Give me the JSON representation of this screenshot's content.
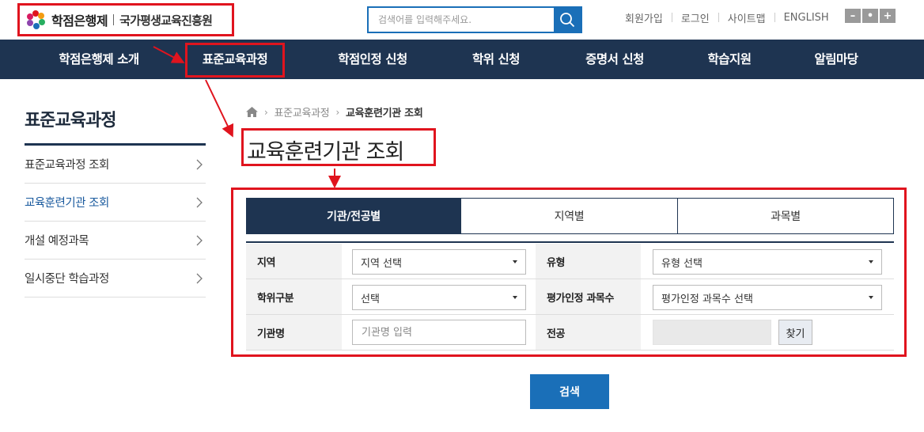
{
  "header": {
    "logo_name": "학점은행제",
    "logo_org": "국가평생교육진흥원",
    "search_placeholder": "검색어를 입력해주세요.",
    "util_links": [
      "회원가입",
      "로그인",
      "사이트맵",
      "ENGLISH"
    ],
    "font_controls": [
      "–",
      "•",
      "+"
    ]
  },
  "gnb": [
    "학점은행제 소개",
    "표준교육과정",
    "학점인정 신청",
    "학위 신청",
    "증명서 신청",
    "학습지원",
    "알림마당"
  ],
  "sidebar": {
    "title": "표준교육과정",
    "items": [
      "표준교육과정 조회",
      "교육훈련기관 조회",
      "개설 예정과목",
      "일시중단 학습과정"
    ]
  },
  "breadcrumb": {
    "parent": "표준교육과정",
    "current": "교육훈련기관 조회"
  },
  "page_title": "교육훈련기관 조회",
  "tabs": [
    "기관/전공별",
    "지역별",
    "과목별"
  ],
  "form": {
    "region_label": "지역",
    "region_value": "지역 선택",
    "type_label": "유형",
    "type_value": "유형 선택",
    "degree_label": "학위구분",
    "degree_value": "선택",
    "eval_label": "평가인정 과목수",
    "eval_value": "평가인정 과목수 선택",
    "inst_label": "기관명",
    "inst_placeholder": "기관명 입력",
    "major_label": "전공",
    "find_label": "찾기"
  },
  "search_button": "검색",
  "colors": {
    "navy": "#1e3451",
    "blue": "#1a6fb8",
    "highlight": "#e0141e"
  }
}
